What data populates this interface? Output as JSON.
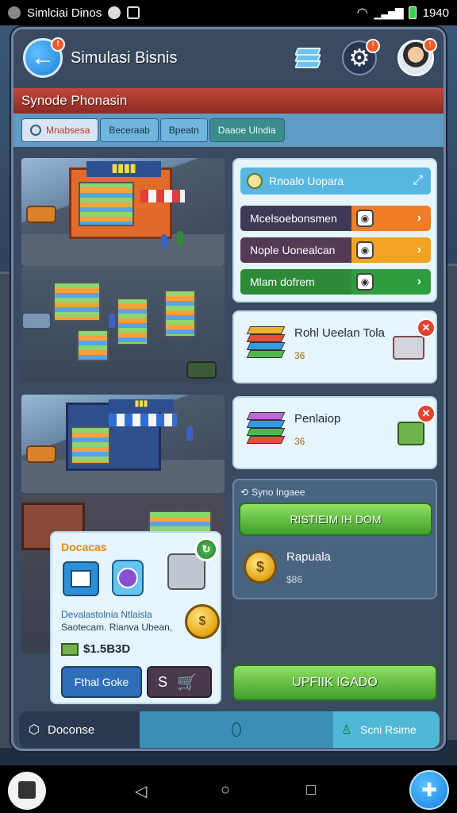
{
  "status_bar": {
    "app_name": "Simlciai Dinos",
    "time": "1940"
  },
  "header": {
    "title": "Simulasi Bisnis",
    "back_badge": "!",
    "settings_badge": "!",
    "avatar_badge": "!"
  },
  "banner": {
    "title": "Synode Phonasin"
  },
  "tabs": [
    {
      "label": "Mnabsesa"
    },
    {
      "label": "Beceraab"
    },
    {
      "label": "Bpeatn"
    },
    {
      "label": "Daaoe Ulndia"
    }
  ],
  "menu_card": {
    "title": "Rnoalo Uopara",
    "rows": [
      {
        "label": "Mcelsoebonsmen",
        "color": "#f07d28"
      },
      {
        "label": "Nople Uonealcan",
        "color": "#f2a324"
      },
      {
        "label": "Mlam dofrem",
        "color": "#2f9d3e"
      }
    ]
  },
  "card_one": {
    "title": "Rohl Ueelan Tola",
    "value": "36"
  },
  "card_two": {
    "title": "Penlaiop",
    "value": "36"
  },
  "sync_card": {
    "header": "Syno Ingaee",
    "button_label": "RISTIEIM IH DOM",
    "item_title": "Rapuala",
    "item_value": "$86"
  },
  "popup": {
    "title": "Docacas",
    "description_line1": "Devalastolnia Ntlaisla",
    "description_line2": "Saotecam. Rianva Ubean,",
    "price": "$1.5B3D",
    "primary_button": "Fthal Goke",
    "secondary_button": "S"
  },
  "upgrade_button": {
    "label": "UPFIIK IGADO"
  },
  "bottom_bar": {
    "left_label": "Doconse",
    "right_label": "Scni Rsime"
  },
  "colors": {
    "accent_blue": "#1f7fd6",
    "banner_red": "#c0463a",
    "action_green": "#3f9e2c",
    "tab_blue": "#5f9cc5"
  }
}
